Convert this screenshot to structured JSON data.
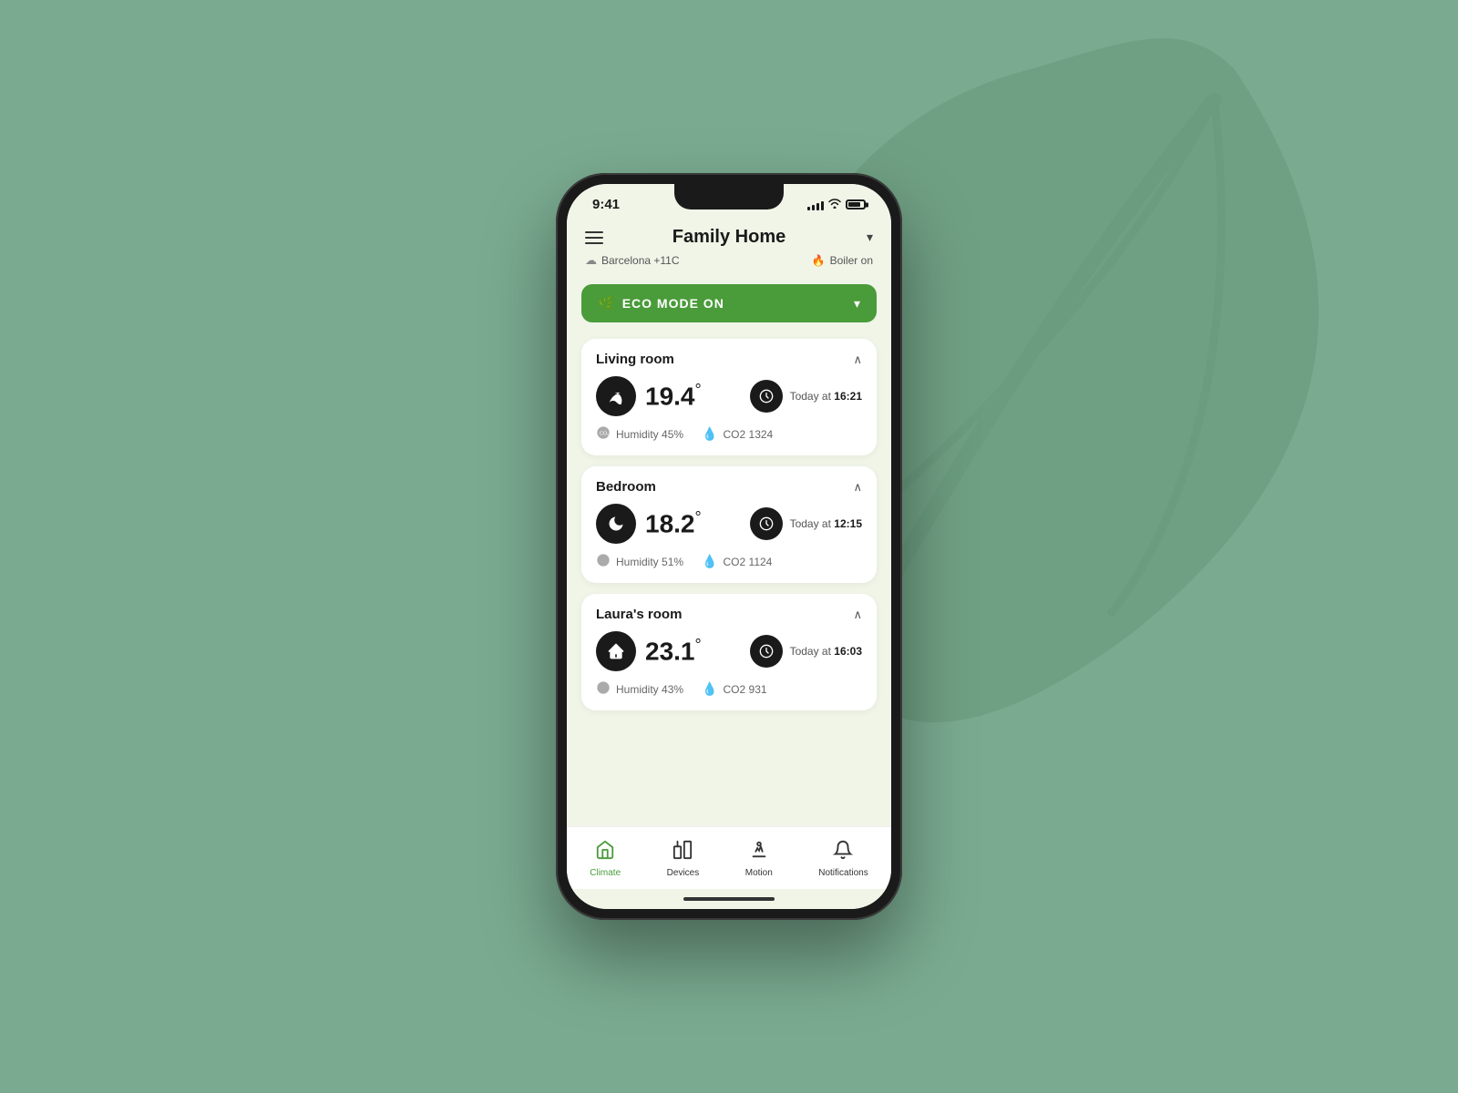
{
  "background": {
    "color": "#7aab90"
  },
  "status_bar": {
    "time": "9:41",
    "signal_bars": [
      3,
      5,
      7,
      9,
      11
    ],
    "battery_level": "80%"
  },
  "header": {
    "menu_label": "Menu",
    "title": "Family Home",
    "dropdown_label": "Dropdown",
    "location": "Barcelona +11C",
    "boiler_status": "Boiler on"
  },
  "eco_mode": {
    "label": "ECO MODE ON",
    "icon": "🌿"
  },
  "rooms": [
    {
      "name": "Living room",
      "temperature": "19.4",
      "temp_unit": "°",
      "icon": "🌿",
      "icon_type": "leaf",
      "schedule_label": "Today at",
      "schedule_time": "16:21",
      "humidity_label": "Humidity",
      "humidity_value": "45%",
      "co2_label": "CO2",
      "co2_value": "1324"
    },
    {
      "name": "Bedroom",
      "temperature": "18.2",
      "temp_unit": "°",
      "icon": "🌙",
      "icon_type": "moon",
      "schedule_label": "Today at",
      "schedule_time": "12:15",
      "humidity_label": "Humidity",
      "humidity_value": "51%",
      "co2_label": "CO2",
      "co2_value": "1124"
    },
    {
      "name": "Laura's room",
      "temperature": "23.1",
      "temp_unit": "°",
      "icon": "🏠",
      "icon_type": "home",
      "schedule_label": "Today at",
      "schedule_time": "16:03",
      "humidity_label": "Humidity",
      "humidity_value": "43%",
      "co2_label": "CO2",
      "co2_value": "931"
    }
  ],
  "nav": {
    "items": [
      {
        "id": "climate",
        "label": "Climate",
        "icon": "🏠",
        "active": true
      },
      {
        "id": "devices",
        "label": "Devices",
        "icon": "⚙",
        "active": false
      },
      {
        "id": "motion",
        "label": "Motion",
        "icon": "🐾",
        "active": false
      },
      {
        "id": "notifications",
        "label": "Notifications",
        "icon": "🔔",
        "active": false
      }
    ]
  }
}
